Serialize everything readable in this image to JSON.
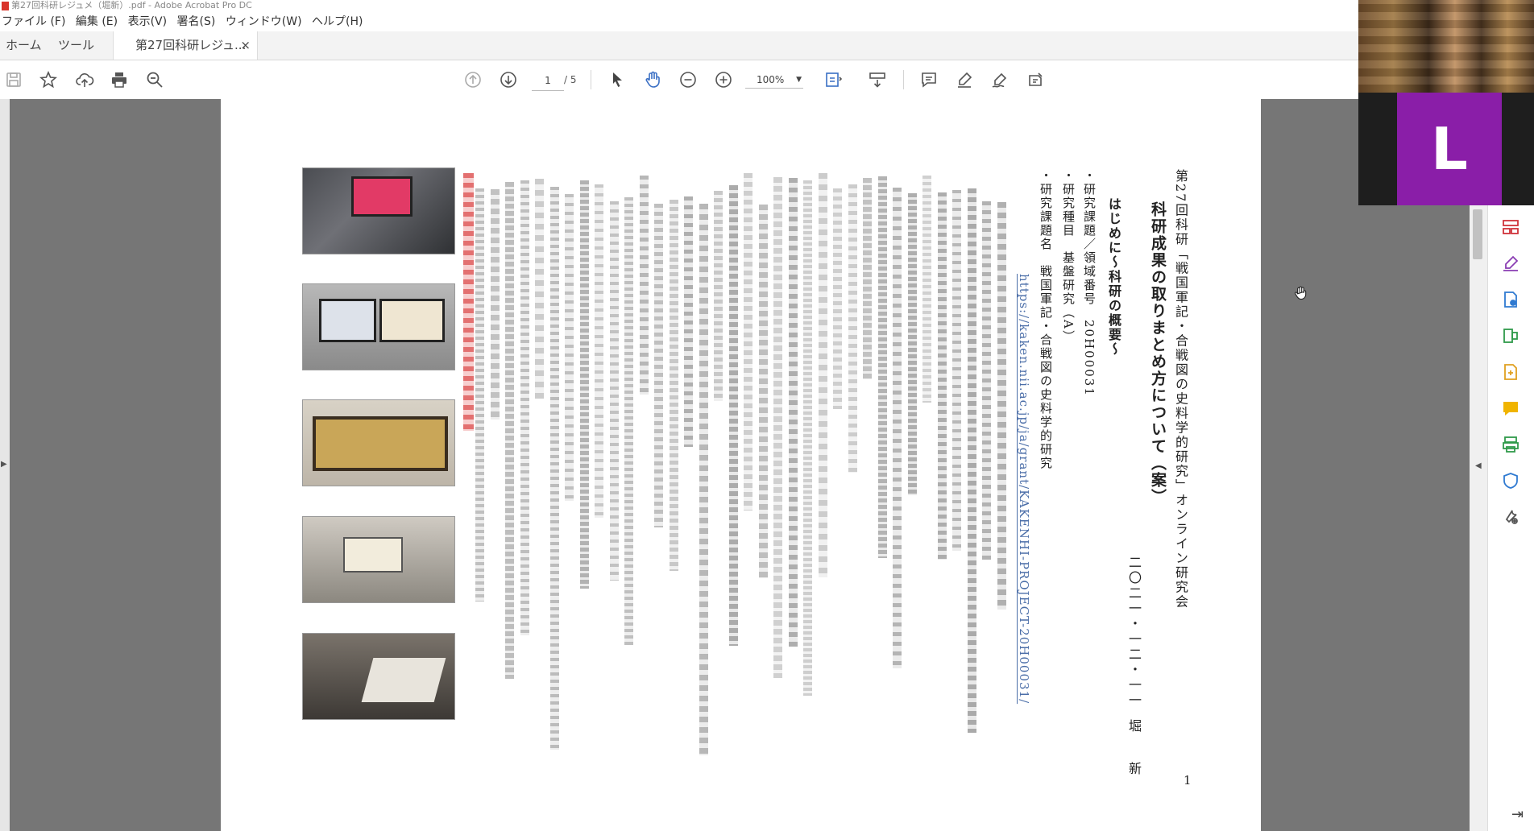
{
  "window": {
    "title": "第27回科研レジュメ（堀新）.pdf - Adobe Acrobat Pro DC"
  },
  "menu": [
    "ファイル (F)",
    "編集 (E)",
    "表示(V)",
    "署名(S)",
    "ウィンドウ(W)",
    "ヘルプ(H)"
  ],
  "tabs": {
    "home": "ホーム",
    "tools": "ツール",
    "document": "第27回科研レジュ...",
    "close": "×"
  },
  "toolbar": {
    "page_current": "1",
    "page_total": "/ 5",
    "zoom": "100%"
  },
  "document": {
    "title_line": "第27回科研「戦国軍記・合戦図の史料学的研究」オンライン研究会",
    "main_title": "科研成果の取りまとめ方について（案）",
    "date": "二〇二一・一二・一一",
    "author": "堀 新",
    "heading": "はじめに～科研の概要～",
    "items": [
      "・研究課題／領域番号　20H00031",
      "・研究種目　基盤研究（A）",
      "・研究課題名　戦国軍記・合戦図の史料学的研究"
    ],
    "link": "https://kaken.nii.ac.jp/ja/grant/KAKENHI-PROJECT-20H00031/",
    "page_number": "1"
  },
  "participant": {
    "initial": "L"
  },
  "icons": {
    "save": "save-icon",
    "bookmark": "star-icon",
    "upload": "cloud-upload-icon",
    "print": "print-icon",
    "search": "zoom-search-icon",
    "prev": "page-up-icon",
    "next": "page-down-icon",
    "select": "cursor-icon",
    "hand": "hand-icon",
    "zoom_out": "zoom-out-icon",
    "zoom_in": "zoom-in-icon"
  },
  "colors": {
    "accent": "#8a1ea8",
    "link": "#4b6ea8",
    "doc_bg": "#767676"
  }
}
